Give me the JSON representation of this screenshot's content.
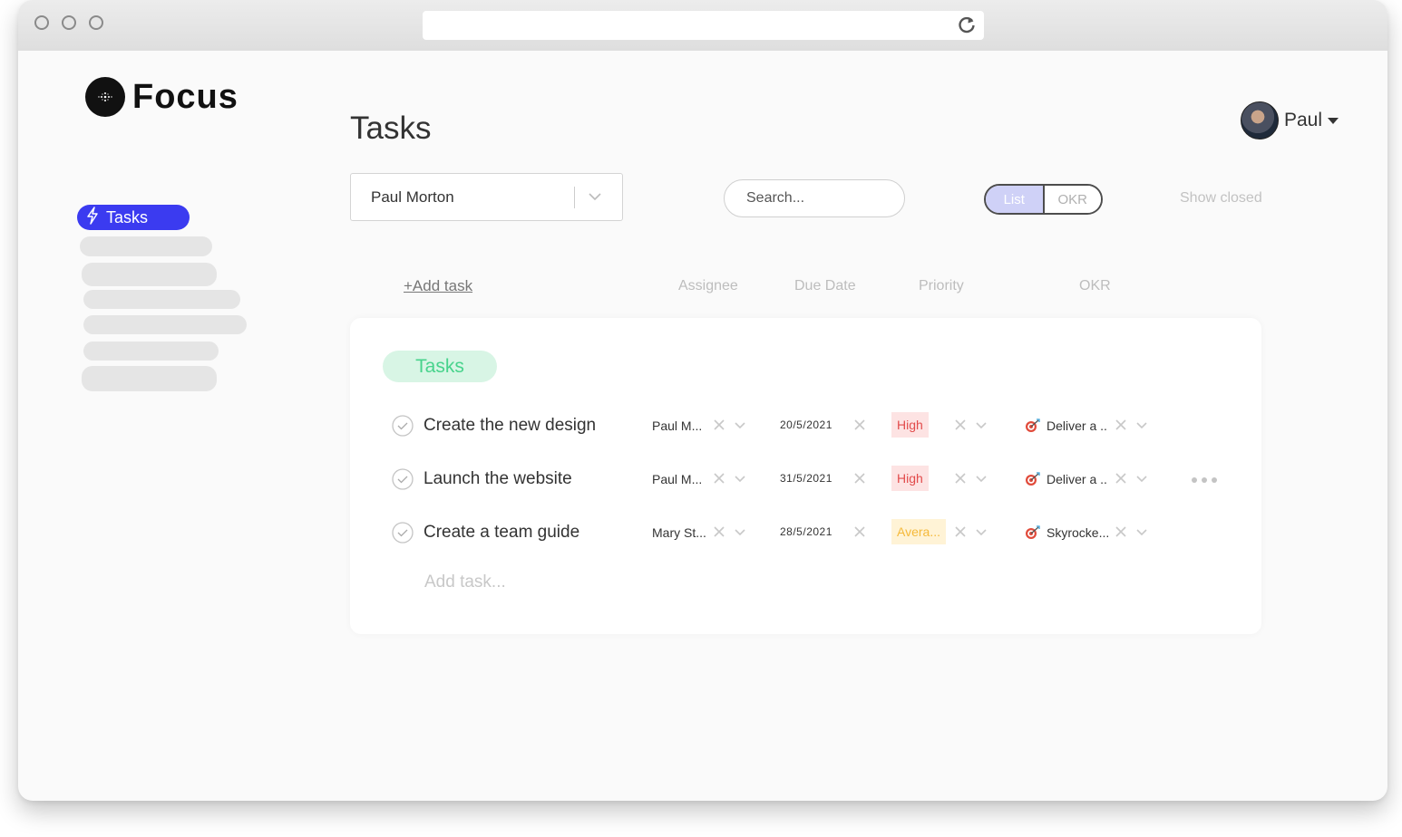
{
  "app": {
    "name": "Focus"
  },
  "user": {
    "name": "Paul"
  },
  "sidebar": {
    "items": [
      {
        "label": "Tasks",
        "icon": "lightning-icon",
        "active": true
      }
    ]
  },
  "page": {
    "title": "Tasks"
  },
  "toolbar": {
    "assignee_filter": "Paul Morton",
    "search_placeholder": "Search...",
    "view_toggle": {
      "options": [
        "List",
        "OKR"
      ],
      "selected": "List"
    },
    "show_closed": "Show closed"
  },
  "table": {
    "add_task_link": "+Add task",
    "columns": [
      "Assignee",
      "Due Date",
      "Priority",
      "OKR"
    ],
    "group": "Tasks",
    "rows": [
      {
        "name": "Create the new design",
        "assignee": "Paul M...",
        "due": "20/5/2021",
        "priority": "High",
        "okr": "Deliver a .."
      },
      {
        "name": "Launch the website",
        "assignee": "Paul M...",
        "due": "31/5/2021",
        "priority": "High",
        "okr": "Deliver a .."
      },
      {
        "name": "Create a team guide",
        "assignee": "Mary St...",
        "due": "28/5/2021",
        "priority": "Avera...",
        "okr": "Skyrocke..."
      }
    ],
    "add_task_placeholder": "Add task..."
  },
  "colors": {
    "accent": "#3b3bf0",
    "group_green": "#47d38c",
    "priority_high": "#e24b4b",
    "priority_average": "#f5b93a"
  }
}
